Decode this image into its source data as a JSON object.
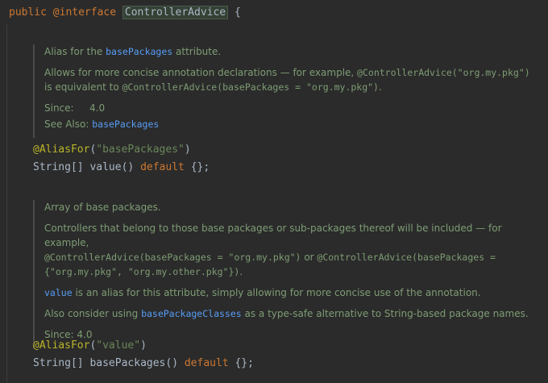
{
  "header": {
    "kw_public": "public",
    "kw_interface": "@interface",
    "class_name": "ControllerAdvice",
    "brace": "{"
  },
  "doc1": {
    "summary_pre": "Alias for the ",
    "summary_link": "basePackages",
    "summary_post": " attribute.",
    "p2_pre": "Allows for more concise annotation declarations — for example, ",
    "p2_code1": "@ControllerAdvice(\"org.my.pkg\")",
    "p2_mid": "is equivalent to ",
    "p2_code2": "@ControllerAdvice(basePackages = \"org.my.pkg\")",
    "p2_post": ".",
    "since_label": "Since:",
    "since_value": "4.0",
    "see_label": "See Also:",
    "see_link": "basePackages"
  },
  "method1": {
    "annotation": "@AliasFor",
    "ann_arg": "\"basePackages\"",
    "type": "String[]",
    "name": "value",
    "kw_default": "default",
    "default_val": "{}"
  },
  "doc2": {
    "summary": "Array of base packages.",
    "p2_pre": "Controllers that belong to those base packages or sub-packages thereof will be included — for example,",
    "p2_code1": "@ControllerAdvice(basePackages = \"org.my.pkg\")",
    "p2_or": " or ",
    "p2_code2": "@ControllerAdvice(basePackages =",
    "p2_code3": "{\"org.my.pkg\", \"org.my.other.pkg\"})",
    "p2_post": ".",
    "p3_code": "value",
    "p3_text": " is an alias for this attribute, simply allowing for more concise use of the annotation.",
    "p4_pre": "Also consider using ",
    "p4_link": "basePackageClasses",
    "p4_post": " as a type-safe alternative to String-based package names.",
    "since": "Since: 4.0"
  },
  "method2": {
    "annotation": "@AliasFor",
    "ann_arg": "\"value\"",
    "type": "String[]",
    "name": "basePackages",
    "kw_default": "default",
    "default_val": "{}"
  }
}
